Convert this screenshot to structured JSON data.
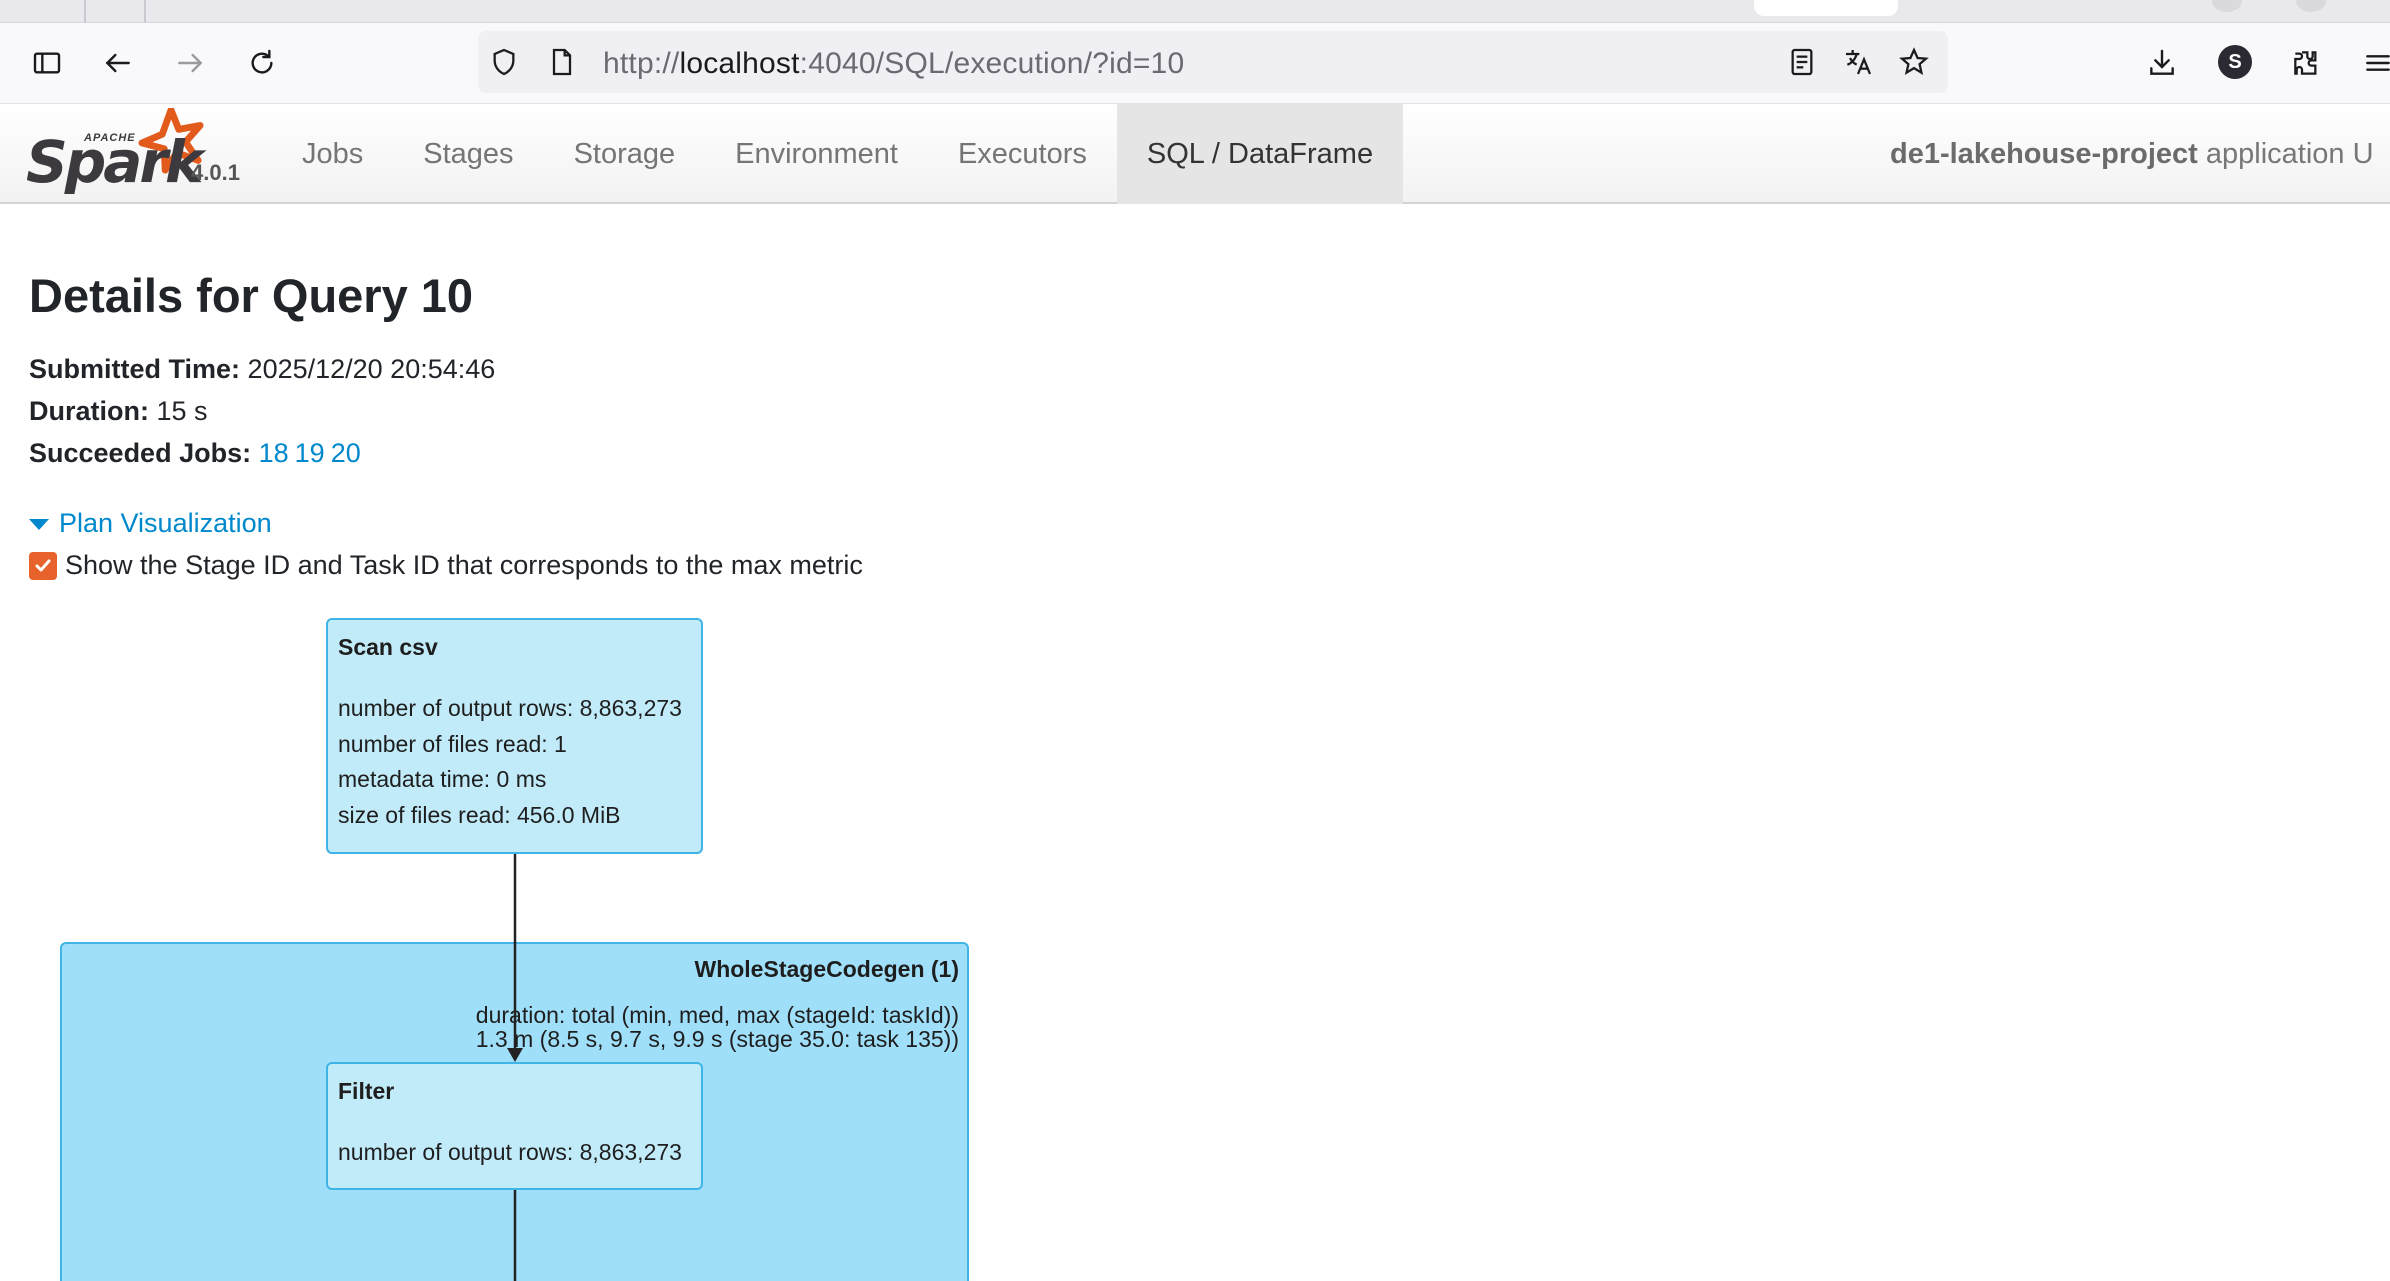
{
  "browser": {
    "url_prefix": "http://",
    "url_host": "localhost",
    "url_rest": ":4040/SQL/execution/?id=10",
    "profile_initial": "S"
  },
  "header": {
    "logo_text": "Spark",
    "logo_sub": "APACHE",
    "version": "4.0.1",
    "tabs": [
      {
        "label": "Jobs",
        "active": false
      },
      {
        "label": "Stages",
        "active": false
      },
      {
        "label": "Storage",
        "active": false
      },
      {
        "label": "Environment",
        "active": false
      },
      {
        "label": "Executors",
        "active": false
      },
      {
        "label": "SQL / DataFrame",
        "active": true
      }
    ],
    "app_name": "de1-lakehouse-project",
    "app_suffix": "application U"
  },
  "details": {
    "title": "Details for Query 10",
    "submitted_label": "Submitted Time:",
    "submitted_value": "2025/12/20 20:54:46",
    "duration_label": "Duration:",
    "duration_value": "15 s",
    "jobs_label": "Succeeded Jobs:",
    "jobs": [
      "18",
      "19",
      "20"
    ],
    "plan_toggle": "Plan Visualization",
    "max_metric_label": "Show the Stage ID and Task ID that corresponds to the max metric",
    "max_metric_checked": true
  },
  "plan": {
    "scan": {
      "name": "Scan csv",
      "metrics": [
        "number of output rows: 8,863,273",
        "number of files read: 1",
        "metadata time: 0 ms",
        "size of files read: 456.0 MiB"
      ]
    },
    "codegen": {
      "name": "WholeStageCodegen (1)",
      "metric_line1": "duration: total (min, med, max (stageId: taskId))",
      "metric_line2": "1.3 m (8.5 s, 9.7 s, 9.9 s (stage 35.0: task 135))"
    },
    "filter": {
      "name": "Filter",
      "metrics": [
        "number of output rows: 8,863,273"
      ]
    }
  },
  "colors": {
    "link": "#0088cc",
    "checkbox": "#e8622c",
    "node_fill": "#c2ebfa",
    "cluster_fill": "#a0dff9",
    "node_border": "#3fb4e6"
  }
}
